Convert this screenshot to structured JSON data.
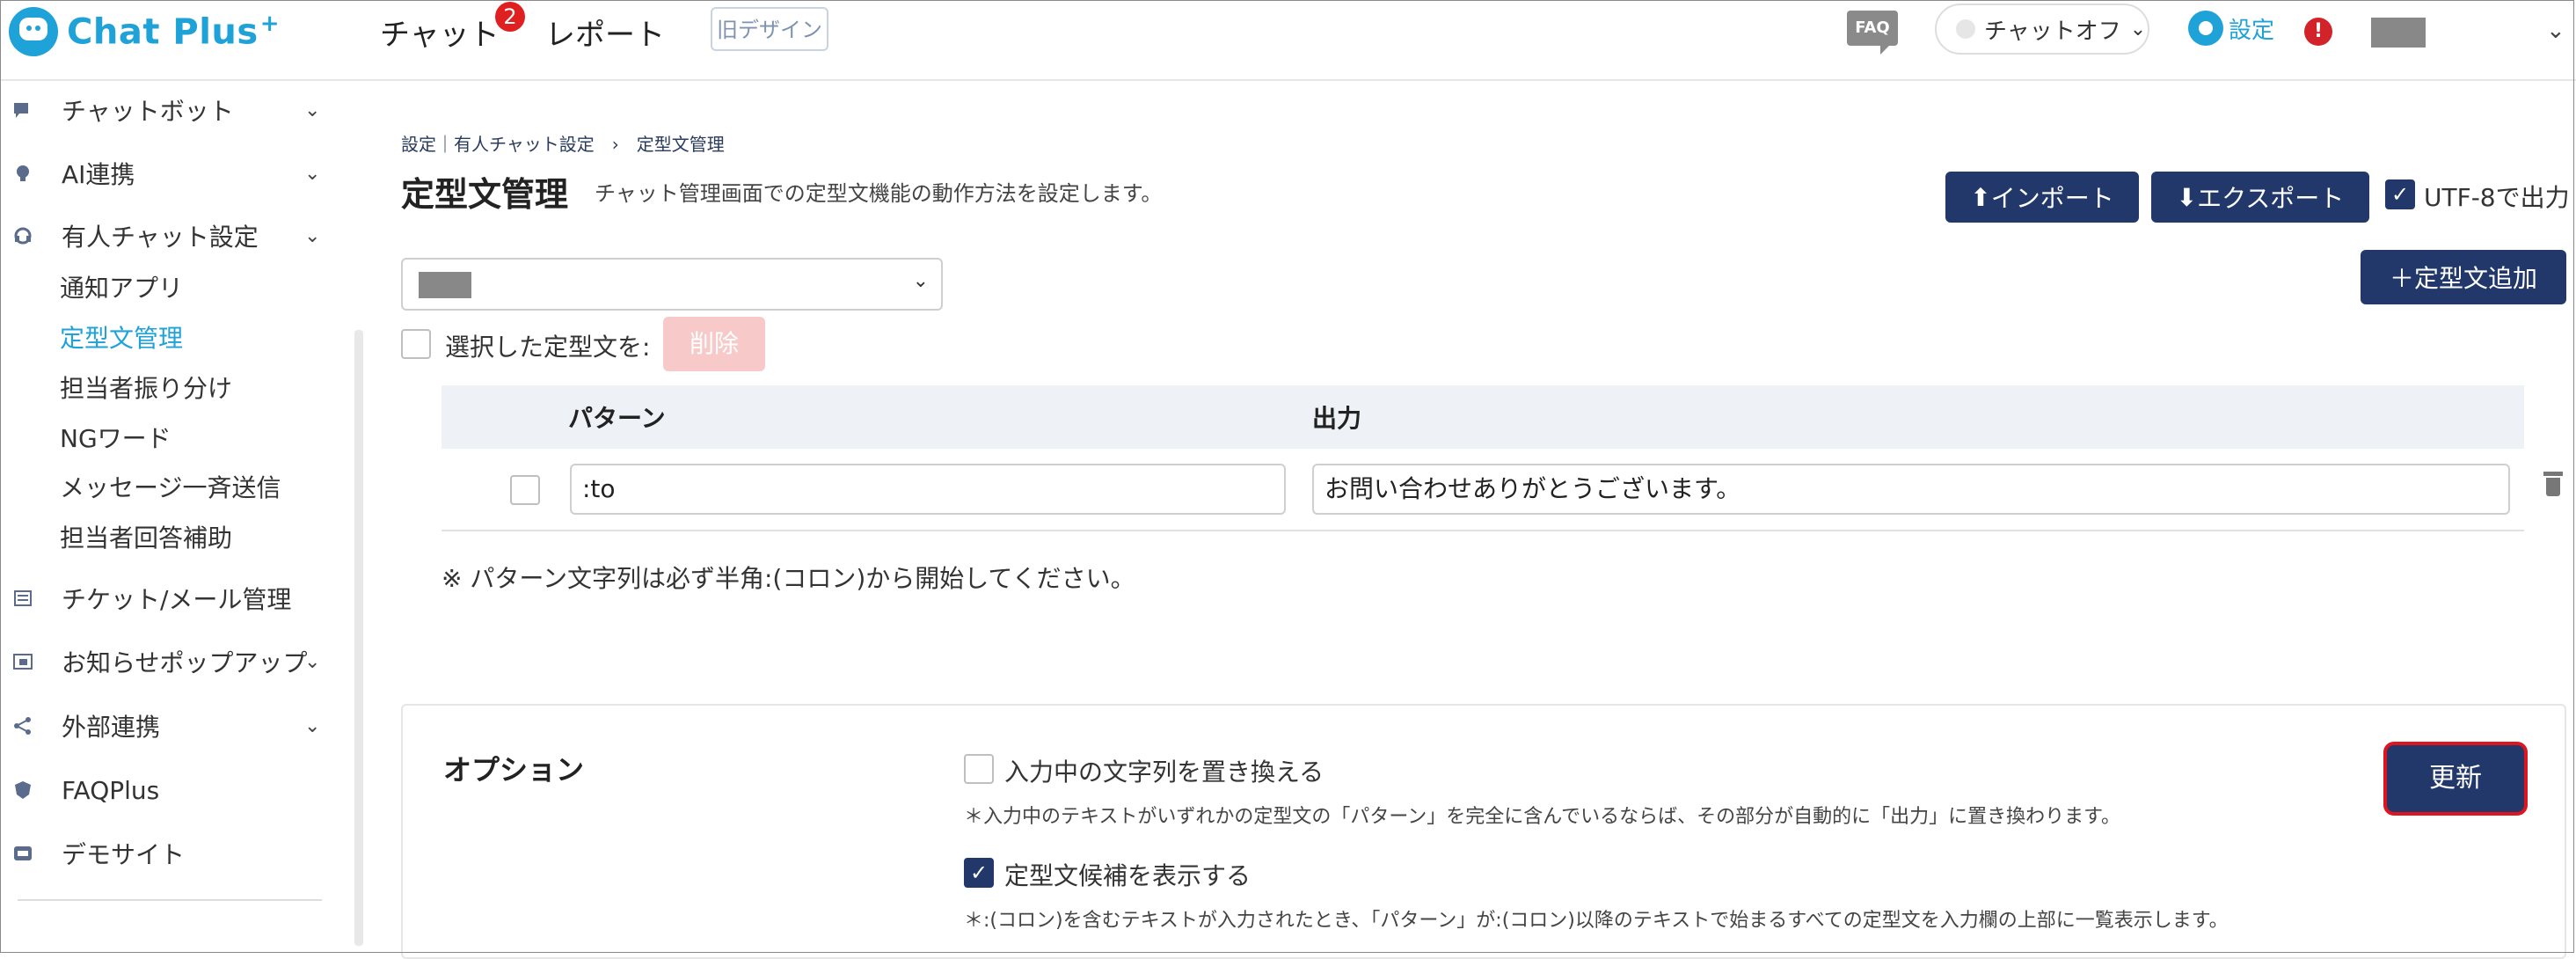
{
  "header": {
    "logo_text": "Chat Plus",
    "logo_plus": "+",
    "nav_chat": "チャット",
    "chat_badge": "2",
    "nav_report": "レポート",
    "old_design": "旧デザイン",
    "faq": "FAQ",
    "chat_status": "チャットオフ",
    "settings": "設定",
    "alert": "!"
  },
  "sidebar": {
    "items": [
      {
        "label": "チャットボット",
        "icon": "chat-icon"
      },
      {
        "label": "AI連携",
        "icon": "lightbulb-icon"
      },
      {
        "label": "有人チャット設定",
        "icon": "headset-icon"
      },
      {
        "label": "チケット/メール管理",
        "icon": "ticket-icon"
      },
      {
        "label": "お知らせポップアップ",
        "icon": "popup-icon"
      },
      {
        "label": "外部連携",
        "icon": "share-icon"
      },
      {
        "label": "FAQPlus",
        "icon": "faq-shield-icon"
      },
      {
        "label": "デモサイト",
        "icon": "demo-site-icon"
      }
    ],
    "sub_items": [
      {
        "label": "通知アプリ"
      },
      {
        "label": "定型文管理",
        "active": true
      },
      {
        "label": "担当者振り分け"
      },
      {
        "label": "NGワード"
      },
      {
        "label": "メッセージ一斉送信"
      },
      {
        "label": "担当者回答補助"
      }
    ]
  },
  "main": {
    "breadcrumb": "設定｜有人チャット設定　›　定型文管理",
    "title": "定型文管理",
    "description": "チャット管理画面での定型文機能の動作方法を設定します。",
    "import_label": "インポート",
    "export_label": "エクスポート",
    "utf8_label": "UTF-8で出力",
    "add_label": "定型文追加",
    "selected_label": "選択した定型文を:",
    "delete_label": "削除",
    "table": {
      "col_pattern": "パターン",
      "col_output": "出力",
      "rows": [
        {
          "pattern": ":to",
          "output": "お問い合わせありがとうございます。"
        }
      ]
    },
    "note": "※ パターン文字列は必ず半角:(コロン)から開始してください。"
  },
  "options": {
    "title": "オプション",
    "opt1_label": "入力中の文字列を置き換える",
    "opt1_note": "＊入力中のテキストがいずれかの定型文の「パターン」を完全に含んでいるならば、その部分が自動的に「出力」に置き換わります。",
    "opt2_label": "定型文候補を表示する",
    "opt2_note": "＊:(コロン)を含むテキストが入力されたとき、「パターン」が:(コロン)以降のテキストで始まるすべての定型文を入力欄の上部に一覧表示します。",
    "update_label": "更新"
  },
  "colors": {
    "accent": "#1fa2d8",
    "navy": "#22386b",
    "danger": "#e0141e"
  }
}
